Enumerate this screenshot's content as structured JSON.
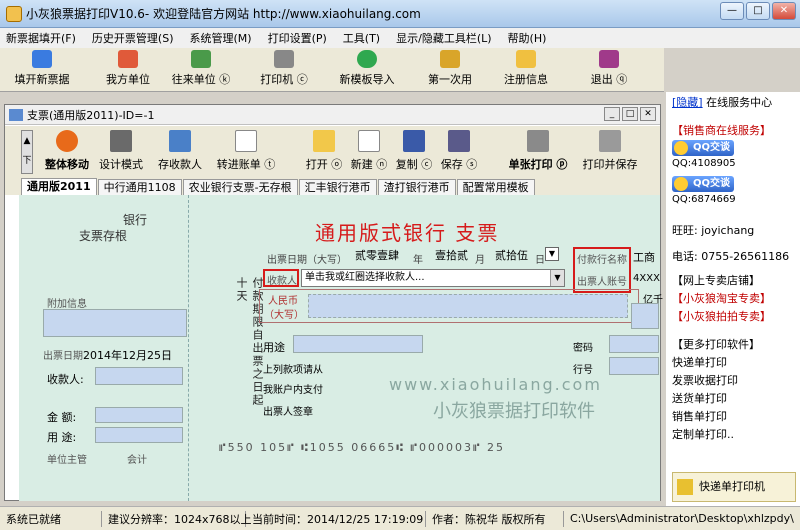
{
  "window": {
    "title": "小灰狼票据打印V10.6- 欢迎登陆官方网站 http://www.xiaohuilang.com"
  },
  "menu": [
    "新票据填开(F)",
    "历史开票管理(S)",
    "系统管理(M)",
    "打印设置(P)",
    "工具(T)",
    "显示/隐藏工具栏(L)",
    "帮助(H)"
  ],
  "toolbar": {
    "new_ticket": "填开新票据",
    "my_unit": "我方单位",
    "partner": "往来单位 ⓚ",
    "printer": "打印机 ⓒ",
    "import_tpl": "新模板导入",
    "first_use": "第一次用",
    "register": "注册信息",
    "exit": "退出 ⓠ"
  },
  "document": {
    "title": "支票(通用版2011)-ID=-1",
    "tools": {
      "move": "整体移动",
      "design": "设计模式",
      "save_payee": "存收款人",
      "transfer": "转进账单 ⓣ",
      "open": "打开 ⓞ",
      "new": "新建 ⓝ",
      "copy": "复制 ⓒ",
      "save": "保存 ⓢ",
      "single_print": "单张打印 ⓟ",
      "print_save": "打印并保存"
    },
    "tabs": [
      "通用版2011",
      "中行通用1108",
      "农业银行支票-无存根",
      "汇丰银行港币",
      "渣打银行港币",
      "配置常用模板"
    ]
  },
  "cheque": {
    "stub_bank": "银行",
    "stub_title": "支票存根",
    "stub_extra": "附加信息",
    "stub_date_label": "出票日期",
    "stub_date_year": "2014",
    "stub_date_month": "12",
    "stub_date_day": "25",
    "stub_payee": "收款人:",
    "stub_amount": "金  额:",
    "stub_usage": "用  途:",
    "stub_mgr": "单位主管",
    "stub_acct": "会计",
    "main_title": "通用版式银行   支票",
    "date_label": "出票日期（大写）",
    "date_year": "贰零壹肆",
    "date_month": "壹拾贰",
    "date_day": "贰拾伍",
    "date_unit_year": "年",
    "date_unit_month": "月",
    "date_unit_day": "日",
    "payer_bank_label": "付款行名称",
    "payer_bank_value": "工商",
    "payee_label": "收款人",
    "payee_select": "单击我或红圈选择收款人...",
    "drawer_account_label": "出票人账号",
    "drawer_account_value": "4XXX",
    "rmb_label": "人民币",
    "rmb_sub": "（大写）",
    "amount_units": [
      "亿",
      "千"
    ],
    "vertical_text": "付款期限自出票之日起十天",
    "usage_label": "用途",
    "password_label": "密码",
    "above_label": "上列款项请从",
    "account_label": "我账户内支付",
    "row_label": "行号",
    "sign_label": "出票人签章",
    "micr": "⑈550 105⑈ ⑆1055  06665⑆ ⑈000003⑈  25"
  },
  "watermark": {
    "url": "www.xiaohuilang.com",
    "name": "小灰狼票据打印软件"
  },
  "right_panel": {
    "hide": "[隐藏]",
    "online": "在线服务中心",
    "sales": "【销售商在线服务】",
    "qq_label": "QQ交谈",
    "qq1": "QQ:4108905",
    "qq2": "QQ:6874669",
    "wangwang": "旺旺: joyichang",
    "phone": "电话: 0755-26561186",
    "shop_title": "【网上专卖店铺】",
    "shop1": "【小灰狼淘宝专卖】",
    "shop2": "【小灰狼拍拍专卖】",
    "more_title": "【更多打印软件】",
    "soft": [
      "快递单打印",
      "发票收据打印",
      "送货单打印",
      "销售单打印",
      "定制单打印.."
    ],
    "bottom": "快递单打印机"
  },
  "status": {
    "ready": "系统已就绪",
    "resolution": "建议分辨率：1024x768以上",
    "time": "当前时间：2014/12/25 17:19:09",
    "author": "作者：陈祝华  版权所有",
    "path": "C:\\Users\\Administrator\\Desktop\\xhlzpdy\\"
  },
  "colors": {
    "cheque_bg": "#d9ede4",
    "title_red": "#d61b1b",
    "link_red": "#c00000",
    "field_blue": "#c6d7ef"
  }
}
